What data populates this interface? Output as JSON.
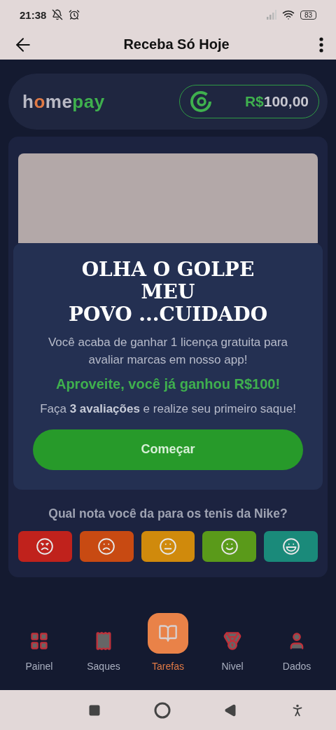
{
  "status_bar": {
    "time": "21:38",
    "battery": "83"
  },
  "app_bar": {
    "title": "Receba Só Hoje"
  },
  "header": {
    "logo": [
      {
        "text": "h",
        "kind": "plain"
      },
      {
        "text": "o",
        "kind": "accent"
      },
      {
        "text": "me",
        "kind": "plain"
      },
      {
        "text": "pay",
        "kind": "brand"
      }
    ],
    "balance": {
      "currency": "R$",
      "amount": "100,00"
    }
  },
  "modal": {
    "caption": [
      "OLHA O GOLPE",
      "MEU",
      "POVO ...CUIDADO"
    ],
    "intro": "Você acaba de ganhar 1 licença gratuita para avaliar marcas em nosso app!",
    "highlight": "Aproveite, você já ganhou R$100!",
    "body": "Faça **3 avaliações** e realize seu primeiro saque!",
    "button": "Começar"
  },
  "question": "Qual nota você da para os tenis da Nike?",
  "ratings": [
    {
      "kind": "angry",
      "color": "#c0221c"
    },
    {
      "kind": "sad",
      "color": "#c84a12"
    },
    {
      "kind": "neutral",
      "color": "#d08a0c"
    },
    {
      "kind": "happy",
      "color": "#5a9a1a"
    },
    {
      "kind": "laugh",
      "color": "#1a8a7a"
    }
  ],
  "nav": [
    {
      "label": "Painel",
      "kind": "grid",
      "selected": false
    },
    {
      "label": "Saques",
      "kind": "receipt",
      "selected": false
    },
    {
      "label": "Tarefas",
      "kind": "book",
      "selected": true
    },
    {
      "label": "Nivel",
      "kind": "medal",
      "selected": false
    },
    {
      "label": "Dados",
      "kind": "user",
      "selected": false
    }
  ]
}
